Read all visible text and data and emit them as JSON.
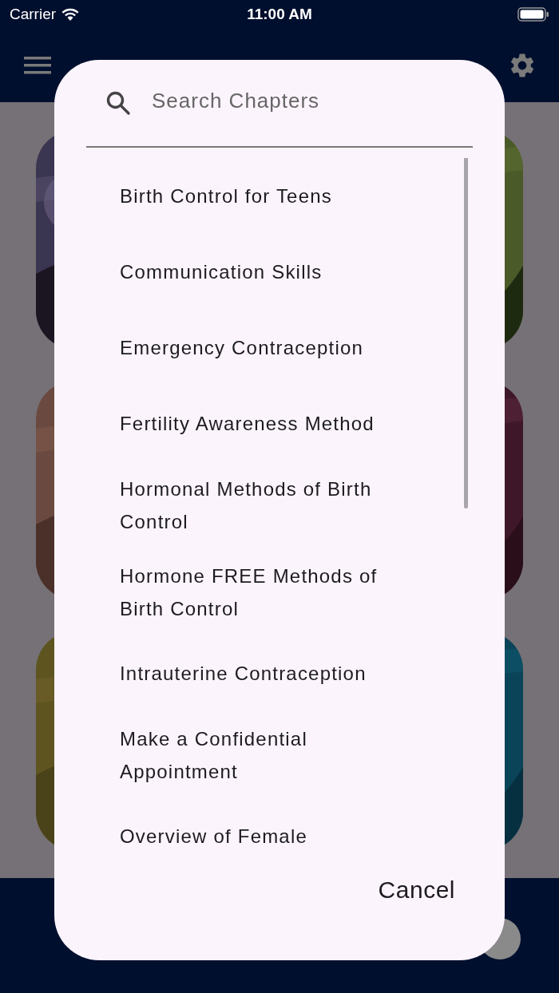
{
  "status_bar": {
    "carrier": "Carrier",
    "time": "11:00 AM"
  },
  "dialog": {
    "search": {
      "placeholder": "Search Chapters"
    },
    "chapters": [
      "Birth Control for Teens",
      "Communication Skills",
      "Emergency Contraception",
      "Fertility Awareness Method",
      "Hormonal Methods of Birth Control",
      "Hormone FREE Methods of Birth Control",
      "Intrauterine Contraception",
      "Make a Confidential Appointment",
      "Overview of Female"
    ],
    "cancel_label": "Cancel"
  }
}
